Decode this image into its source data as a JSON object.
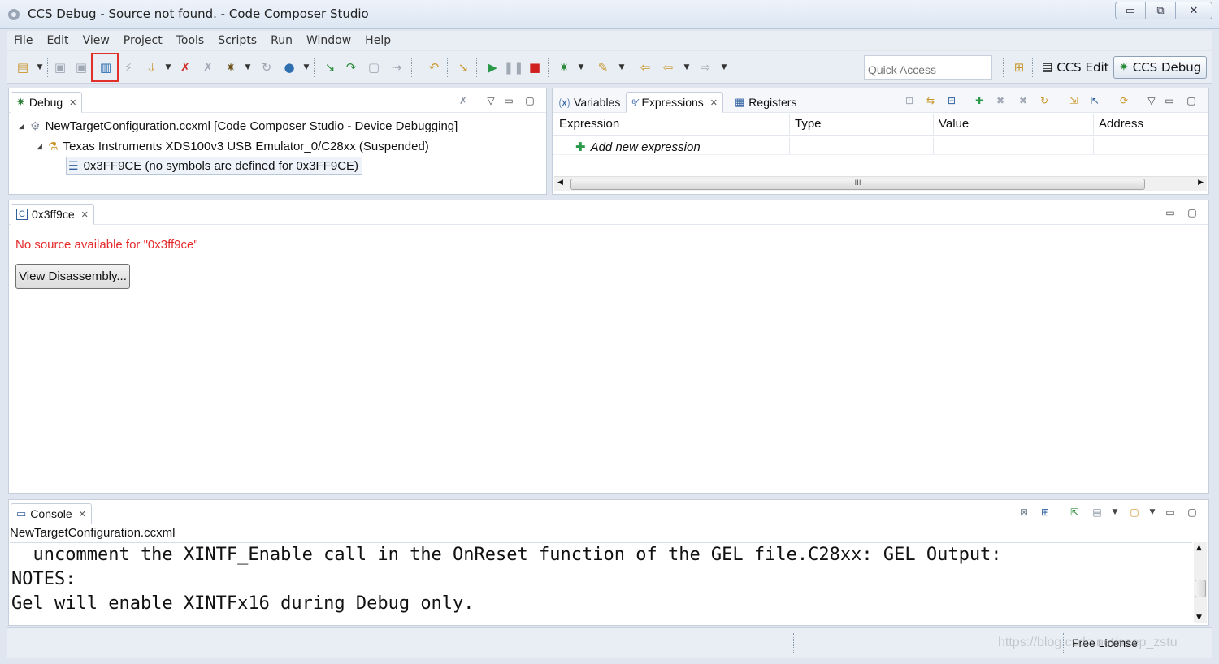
{
  "window": {
    "title": "CCS Debug - Source not found. - Code Composer Studio",
    "minimize": "▭",
    "maximize": "⧉",
    "close": "✕"
  },
  "menu": [
    "File",
    "Edit",
    "View",
    "Project",
    "Tools",
    "Scripts",
    "Run",
    "Window",
    "Help"
  ],
  "toolbar": {
    "quick_access_placeholder": "Quick Access",
    "perspectives": [
      {
        "label": "CCS Edit",
        "icon": "ccs-edit-icon"
      },
      {
        "label": "CCS Debug",
        "icon": "ccs-debug-icon"
      }
    ],
    "highlight_color": "#e0302a"
  },
  "debug_view": {
    "tab": "Debug",
    "tree": [
      {
        "label": "NewTargetConfiguration.ccxml [Code Composer Studio - Device Debugging]"
      },
      {
        "label": "Texas Instruments XDS100v3 USB Emulator_0/C28xx (Suspended)"
      },
      {
        "label": "0x3FF9CE  (no symbols are defined for 0x3FF9CE)"
      }
    ]
  },
  "expressions_view": {
    "tabs": [
      "Variables",
      "Expressions",
      "Registers"
    ],
    "columns": [
      "Expression",
      "Type",
      "Value",
      "Address"
    ],
    "add_row": "Add new expression",
    "scroll_grip": "III"
  },
  "source_view": {
    "tab": "0x3ff9ce",
    "message": "No source available for \"0x3ff9ce\"",
    "button": "View Disassembly...",
    "error_color": "#e52b2b"
  },
  "console_view": {
    "tab": "Console",
    "config_name": "NewTargetConfiguration.ccxml",
    "lines": [
      "  uncomment the XINTF_Enable call in the OnReset function of the GEL file.C28xx: GEL Output:",
      "NOTES:",
      "Gel will enable XINTFx16 during Debug only."
    ]
  },
  "status_bar": {
    "license": "Free License"
  },
  "watermark": "https://blog.csdn.net/seep_zstu"
}
